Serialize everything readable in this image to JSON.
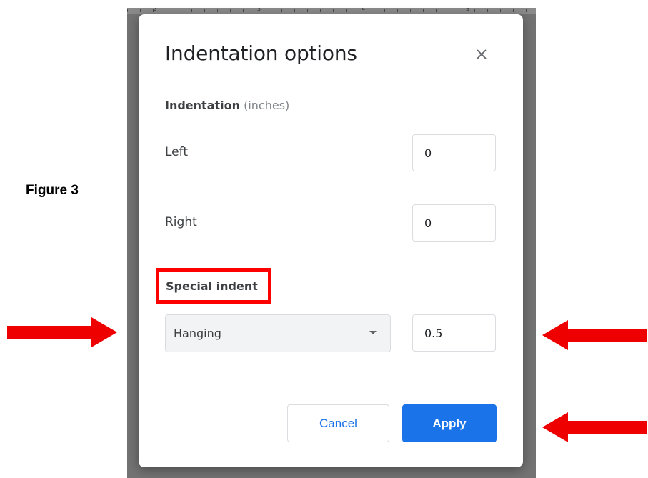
{
  "figure_label": "Figure 3",
  "ruler": {
    "numbers": [
      "2",
      "3",
      "4",
      "5"
    ]
  },
  "dialog": {
    "title": "Indentation options",
    "close_icon": "close-icon",
    "section_heading": "Indentation",
    "section_unit": "(inches)",
    "left_label": "Left",
    "left_value": "0",
    "right_label": "Right",
    "right_value": "0",
    "special_heading": "Special indent",
    "special_select_value": "Hanging",
    "special_value": "0.5",
    "cancel_label": "Cancel",
    "apply_label": "Apply"
  },
  "colors": {
    "accent_blue": "#1a73e8",
    "highlight_red": "#ff0000",
    "arrow_red": "#ee0000",
    "backdrop": "#737373"
  }
}
